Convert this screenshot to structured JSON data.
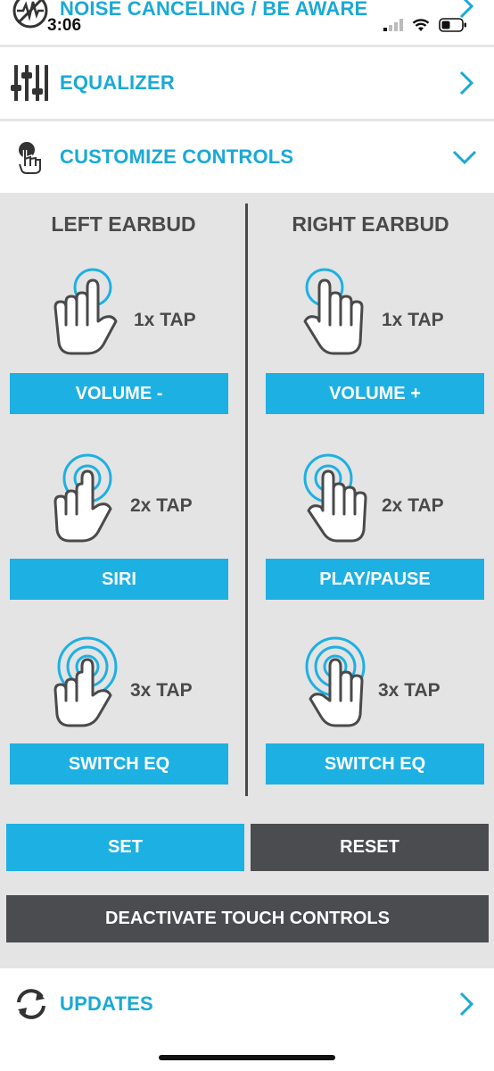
{
  "status_bar": {
    "time": "3:06"
  },
  "menu": {
    "noise_label": "NOISE CANCELING / BE AWARE",
    "equalizer_label": "EQUALIZER",
    "customize_label": "CUSTOMIZE CONTROLS",
    "updates_label": "UPDATES"
  },
  "controls": {
    "left_title": "LEFT EARBUD",
    "right_title": "RIGHT EARBUD",
    "taps": [
      "1x TAP",
      "2x TAP",
      "3x TAP"
    ],
    "left_actions": [
      "VOLUME -",
      "SIRI",
      "SWITCH EQ"
    ],
    "right_actions": [
      "VOLUME +",
      "PLAY/PAUSE",
      "SWITCH EQ"
    ]
  },
  "buttons": {
    "set": "SET",
    "reset": "RESET",
    "deactivate": "DEACTIVATE TOUCH CONTROLS"
  },
  "colors": {
    "accent": "#1db0e3",
    "label_blue": "#1aa9d6",
    "dark_button": "#4a4c50",
    "panel_bg": "#e4e4e4",
    "text_gray": "#4a4a4a"
  }
}
